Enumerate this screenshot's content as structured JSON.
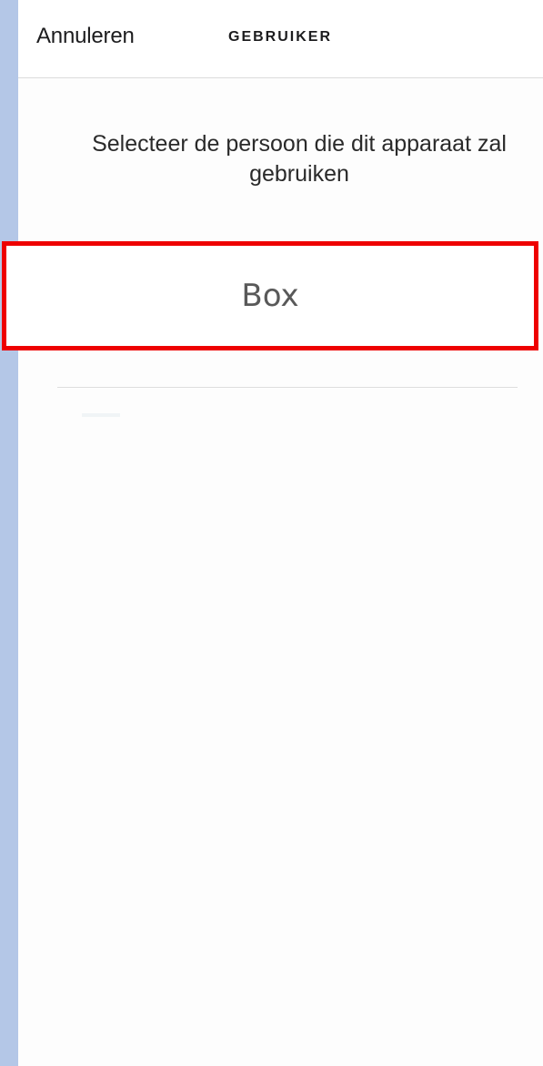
{
  "nav": {
    "cancel_label": "Annuleren",
    "title": "GEBRUIKER"
  },
  "prompt": {
    "text": "Selecteer de persoon die dit apparaat zal gebruiken"
  },
  "options": [
    {
      "label": "Box",
      "highlighted": true
    }
  ],
  "colors": {
    "highlight_border": "#ee0000",
    "side_strip": "#b4c7e7",
    "background": "#fdfdfd"
  }
}
